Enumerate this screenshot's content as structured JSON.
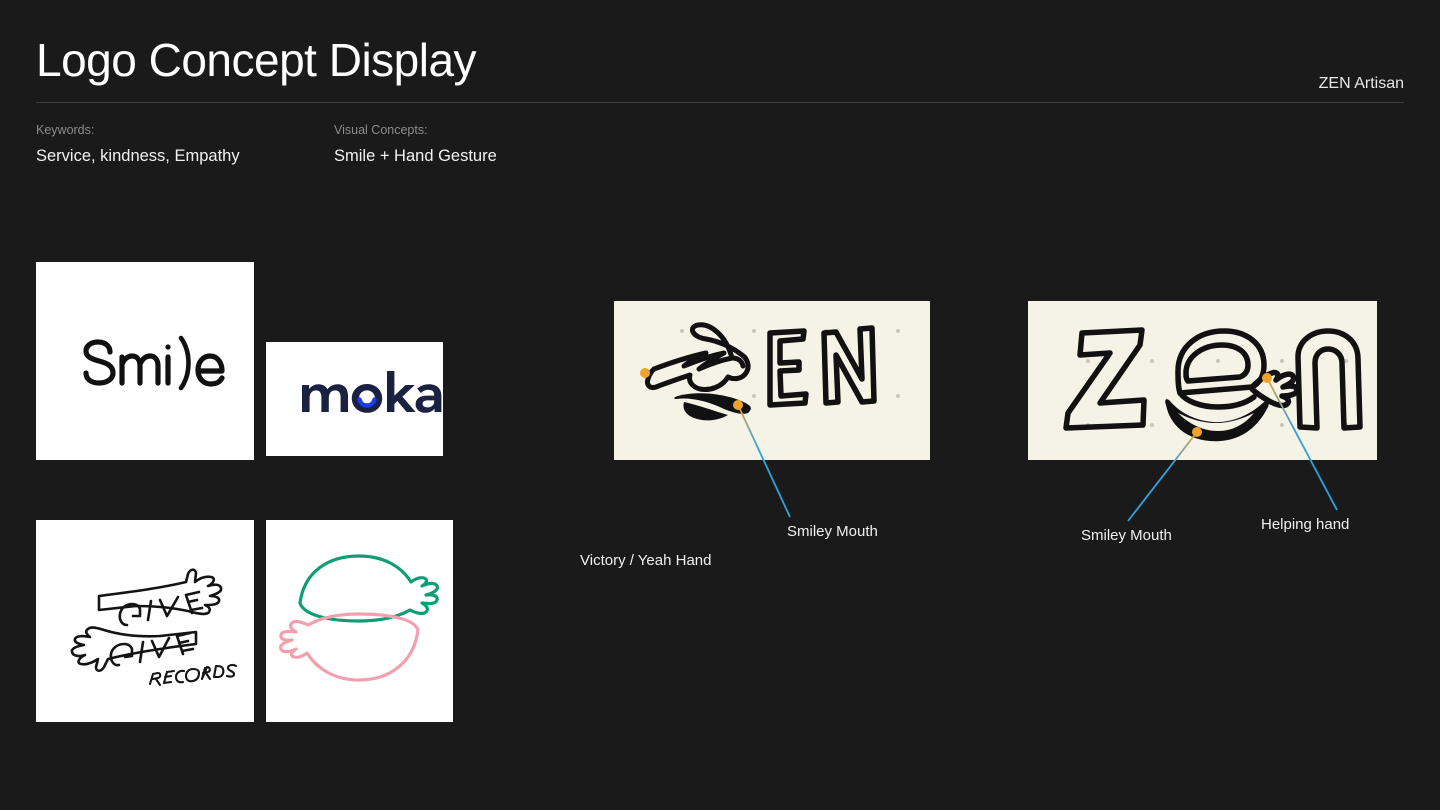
{
  "header": {
    "title": "Logo Concept Display",
    "brand": "ZEN Artisan"
  },
  "meta": {
    "keywords_label": "Keywords:",
    "keywords_value": "Service, kindness, Empathy",
    "concepts_label": "Visual Concepts:",
    "concepts_value": "Smile + Hand Gesture"
  },
  "reference_cards": [
    {
      "id": "card-smile",
      "name": "smile-logo-card",
      "logo_text": "Smi)e",
      "description": "Wordmark 'Smile' where the letter l is drawn as a closing parenthesis forming a smiley face",
      "background": "#ffffff",
      "ink": "#111111"
    },
    {
      "id": "card-moka",
      "name": "moka-logo-card",
      "logo_text": "moka",
      "description": "Wordmark 'moka' with a blue smile arc beneath the letter o",
      "background": "#ffffff",
      "ink": "#1b2141",
      "accent": "#1a3cf0"
    },
    {
      "id": "card-give",
      "name": "give-give-records-logo-card",
      "logo_text": "GIVE GIVE",
      "logo_subtext": "RECORDS",
      "description": "Hand drawn logo with two outstretched arms and hands crossing, lettering GIVE GIVE and RECORDS",
      "background": "#ffffff",
      "ink": "#141414"
    },
    {
      "id": "card-hands",
      "name": "two-hands-circle-logo-card",
      "logo_text": "",
      "description": "Two line-art hands and arms curving into a circle, top half green and bottom half pink",
      "background": "#ffffff",
      "green": "#0f9d76",
      "pink": "#f2a0ad"
    }
  ],
  "sketch_panels": [
    {
      "id": "panel-zen-1",
      "name": "zen-sketch-panel-one",
      "letters": "ZEN",
      "description": "Hand-drawn ZEN lockup where the Z is replaced by a victory hand gesture, with a filled smiley mouth below",
      "background": "#f5f2e6",
      "ink": "#111111",
      "dot_color": "#c9c6b7"
    },
    {
      "id": "panel-zen-2",
      "name": "zen-sketch-panel-two",
      "letters": "Zen",
      "description": "Hand-drawn Zen lockup where the e holds a helping hand, with a filled smiley mouth below",
      "background": "#f5f2e6",
      "ink": "#111111",
      "dot_color": "#c9c6b7"
    }
  ],
  "annotations": [
    {
      "id": "annot-victory",
      "name": "annotation-victory-hand",
      "text": "Victory / Yeah Hand"
    },
    {
      "id": "annot-smiley-1",
      "name": "annotation-smiley-mouth-1",
      "text": "Smiley Mouth"
    },
    {
      "id": "annot-smiley-2",
      "name": "annotation-smiley-mouth-2",
      "text": "Smiley Mouth"
    },
    {
      "id": "annot-helping",
      "name": "annotation-helping-hand",
      "text": "Helping hand"
    }
  ],
  "colors": {
    "background": "#1a1a1a",
    "text_primary": "#f2f2f2",
    "text_muted": "#8c8c8c",
    "divider": "#3d3d3d",
    "leader_dot": "#f0a22e",
    "leader_line_start": "#e8a33d",
    "leader_line_end": "#2aa3e0",
    "card_white": "#ffffff",
    "sketch_cream": "#f5f2e6"
  }
}
